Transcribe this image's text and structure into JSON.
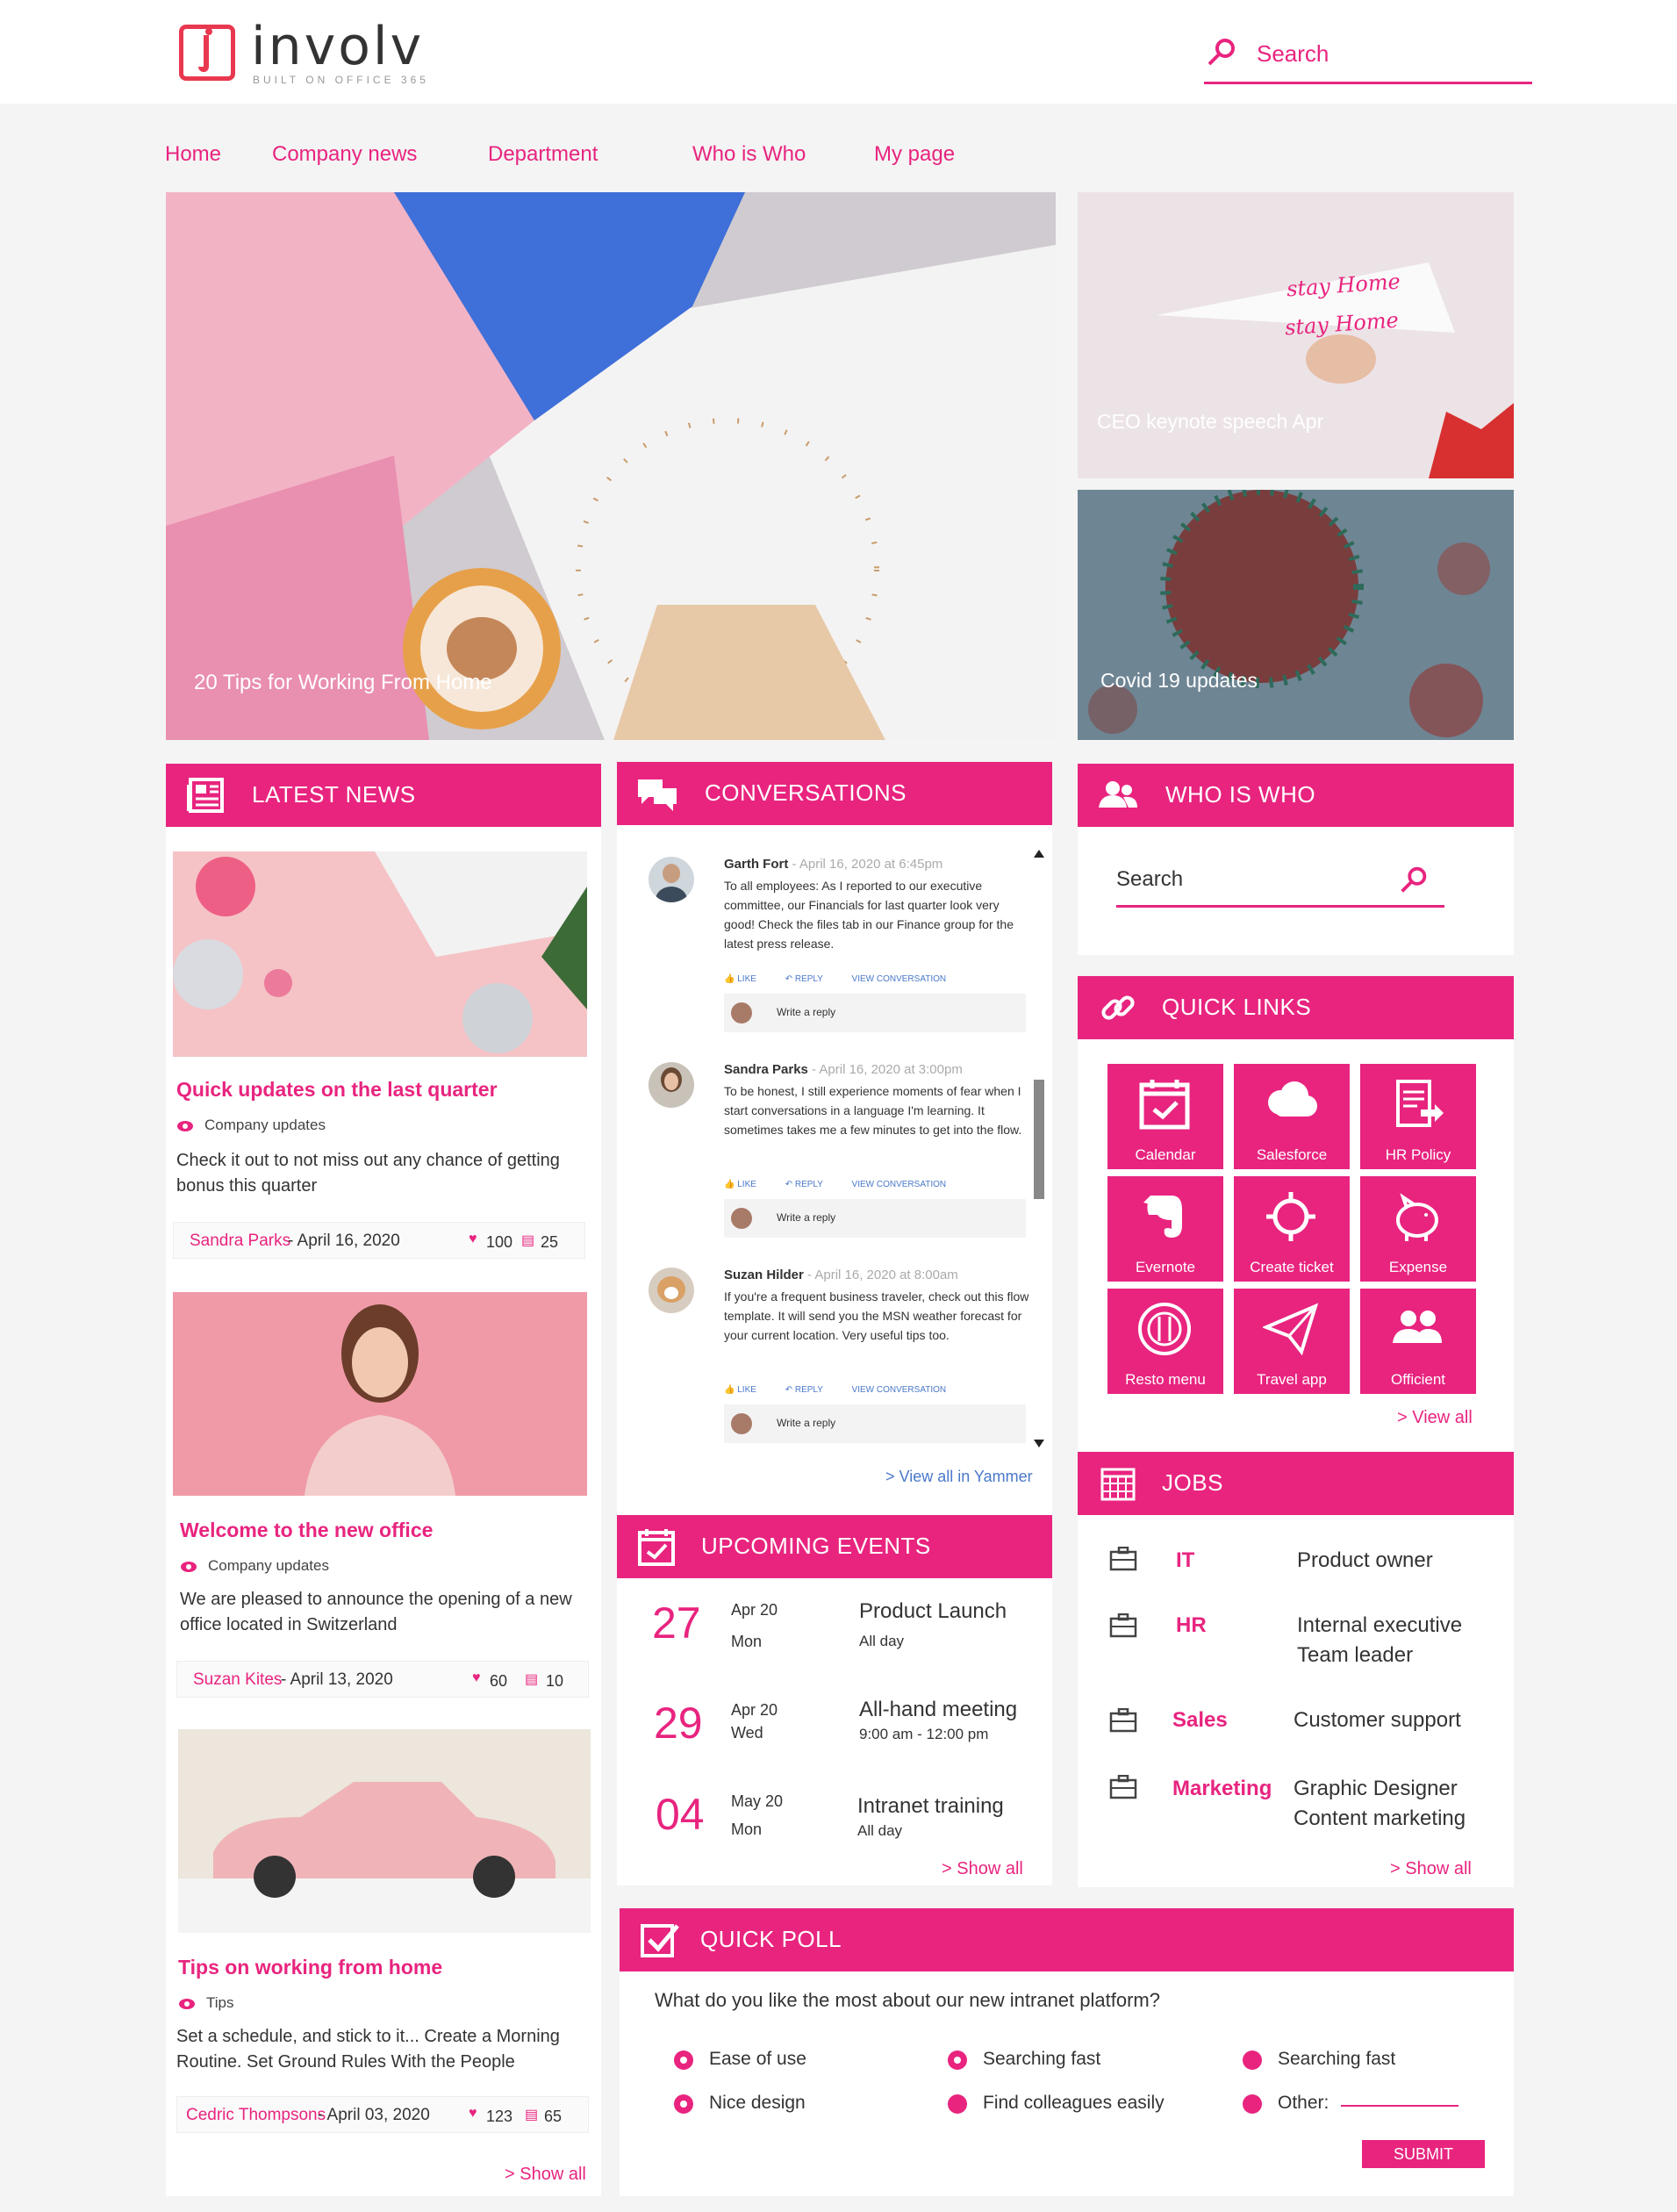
{
  "brand": {
    "name": "involv",
    "tagline": "BUILT ON OFFICE 365",
    "accent": "#e8247f"
  },
  "search": {
    "placeholder": "Search"
  },
  "nav": [
    "Home",
    "Company news",
    "Department",
    "Who is Who",
    "My page"
  ],
  "hero": {
    "main": "20 Tips for Working From Home",
    "side1": "CEO keynote speech Apr",
    "side2": "Covid 19 updates",
    "note1": "stay Home",
    "note2": "stay Home"
  },
  "latest_news": {
    "title": "LATEST NEWS",
    "show_all": "> Show all",
    "items": [
      {
        "title": "Quick updates on the last quarter",
        "category": "Company updates",
        "body": "Check it out to not miss out any chance of getting bonus this quarter",
        "author": "Sandra Parks",
        "date": " - April 16, 2020",
        "likes": "100",
        "comments": "25"
      },
      {
        "title": "Welcome to the new office",
        "category": "Company updates",
        "body": "We are pleased to announce the opening of a new office located in Switzerland",
        "author": "Suzan Kites",
        "date": " - April 13, 2020",
        "likes": "60",
        "comments": "10"
      },
      {
        "title": "Tips on working from home",
        "category": "Tips",
        "body": "Set a schedule, and stick to it... Create a Morning Routine. Set Ground Rules With the People",
        "author": "Cedric Thompsons",
        "date": " - April 03, 2020",
        "likes": "123",
        "comments": "65"
      }
    ]
  },
  "conversations": {
    "title": "CONVERSATIONS",
    "view_all": "> View all in Yammer",
    "like": "LIKE",
    "reply": "REPLY",
    "view": "VIEW CONVERSATION",
    "write": "Write a reply",
    "posts": [
      {
        "name": "Garth Fort",
        "time": " - April 16, 2020 at 6:45pm",
        "text": "To all employees: As I reported to our executive committee, our Financials for last quarter look very good! Check the files tab in our Finance group for the latest press release."
      },
      {
        "name": "Sandra Parks",
        "time": " - April 16, 2020 at 3:00pm",
        "text": "To be honest, I still experience moments of fear when I start conversations in a language I'm learning. It sometimes takes me a few minutes to get into the flow."
      },
      {
        "name": "Suzan Hilder",
        "time": " - April 16, 2020 at 8:00am",
        "text": "If you're a frequent business traveler, check out this flow template. It will send you the MSN weather forecast for your current location. Very useful tips too."
      }
    ]
  },
  "events": {
    "title": "UPCOMING EVENTS",
    "show_all": "> Show all",
    "items": [
      {
        "day": "27",
        "month": "Apr 20",
        "weekday": "Mon",
        "name": "Product Launch",
        "time": "All day"
      },
      {
        "day": "29",
        "month": "Apr 20",
        "weekday": "Wed",
        "name": "All-hand meeting",
        "time": "9:00 am - 12:00 pm"
      },
      {
        "day": "04",
        "month": "May 20",
        "weekday": "Mon",
        "name": "Intranet training",
        "time": "All day"
      }
    ]
  },
  "who": {
    "title": "WHO IS WHO",
    "placeholder": "Search"
  },
  "quick_links": {
    "title": "QUICK LINKS",
    "view_all": "> View all",
    "items": [
      "Calendar",
      "Salesforce",
      "HR Policy",
      "Evernote",
      "Create ticket",
      "Expense",
      "Resto menu",
      "Travel app",
      "Officient"
    ]
  },
  "jobs": {
    "title": "JOBS",
    "show_all": "> Show all",
    "items": [
      {
        "dept": "IT",
        "role1": "Product owner",
        "role2": ""
      },
      {
        "dept": "HR",
        "role1": "Internal executive",
        "role2": "Team leader"
      },
      {
        "dept": "Sales",
        "role1": "Customer support",
        "role2": ""
      },
      {
        "dept": "Marketing",
        "role1": "Graphic Designer",
        "role2": "Content marketing"
      }
    ]
  },
  "poll": {
    "title": "QUICK POLL",
    "question": "What do you like the most about our new intranet platform?",
    "options": [
      "Ease of use",
      "Searching fast",
      "Searching fast",
      "Nice design",
      "Find colleagues easily",
      "Other:"
    ],
    "submit": "SUBMIT"
  }
}
